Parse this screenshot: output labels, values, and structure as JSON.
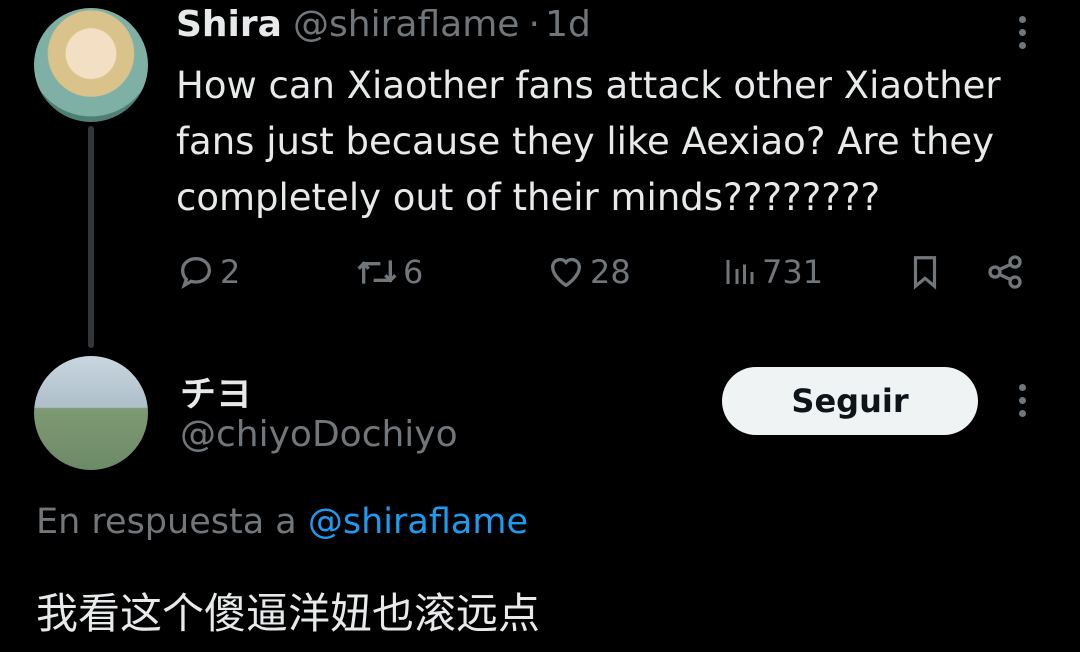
{
  "tweet": {
    "author_name": "Shira",
    "author_handle": "@shiraflame",
    "separator": "·",
    "time": "1d",
    "text": "How can Xiaother fans attack other Xiaother fans just because they like Aexiao? Are they completely out of their minds????????",
    "replies": "2",
    "retweets": "6",
    "likes": "28",
    "views": "731"
  },
  "reply": {
    "author_name": "チヨ",
    "author_handle": "@chiyoDochiyo",
    "follow_label": "Seguir",
    "reply_prefix": "En respuesta a",
    "reply_mention": "@shiraflame",
    "text": "我看这个傻逼洋妞也滚远点"
  },
  "colors": {
    "background": "#000000",
    "text": "#e7e9ea",
    "muted": "#71767b",
    "link": "#1d9bf0",
    "button_bg": "#eff3f4"
  },
  "icons": [
    "reply-icon",
    "retweet-icon",
    "like-icon",
    "views-icon",
    "bookmark-icon",
    "share-icon",
    "more-icon"
  ]
}
